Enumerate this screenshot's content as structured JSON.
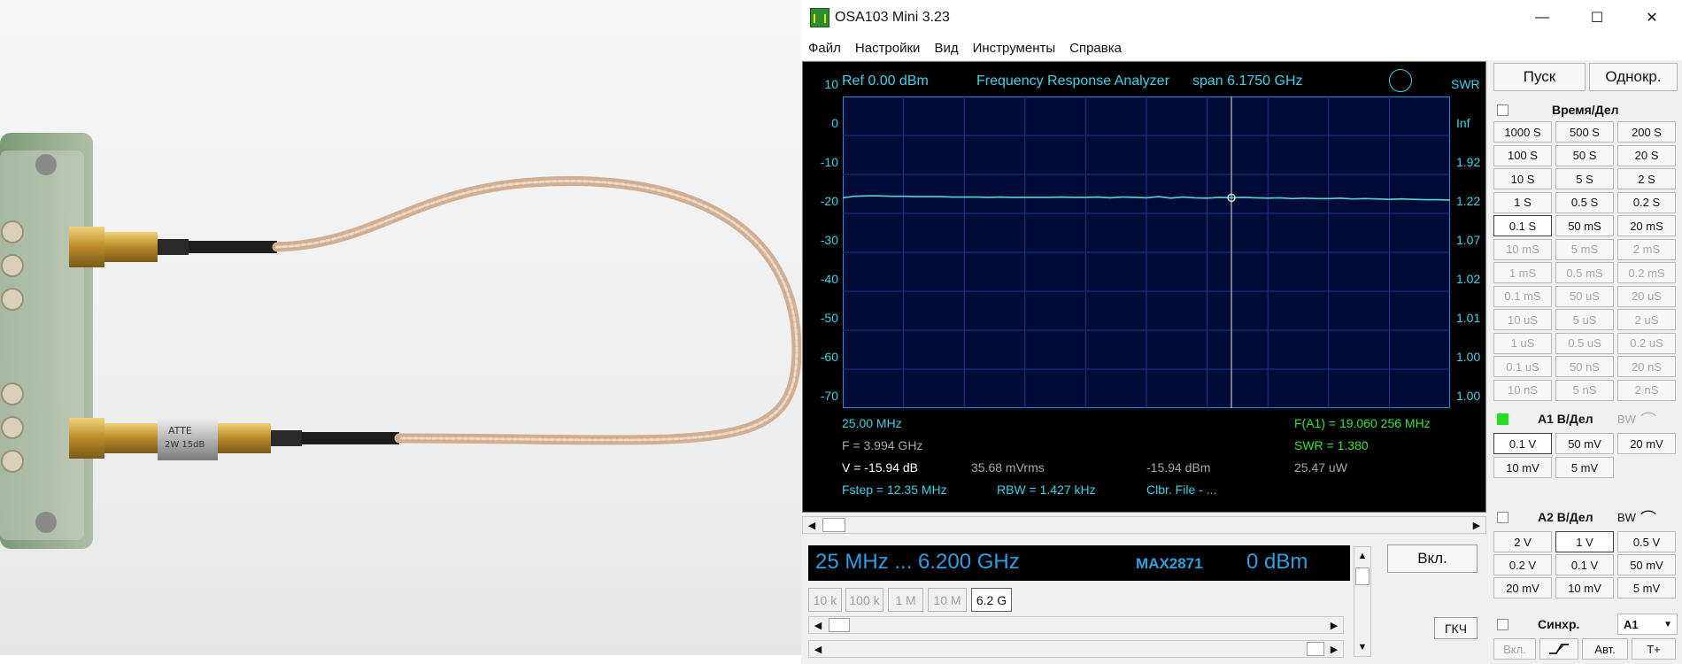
{
  "window": {
    "title": "OSA103 Mini 3.23",
    "controls": [
      "—",
      "☐",
      "✕"
    ]
  },
  "menu": [
    "Файл",
    "Настройки",
    "Вид",
    "Инструменты",
    "Справка"
  ],
  "display": {
    "ref": "Ref  0.00 dBm",
    "mode": "Frequency Response Analyzer",
    "span": "span 6.1750 GHz",
    "left_axis": [
      "10",
      "0",
      "-10",
      "-20",
      "-30",
      "-40",
      "-50",
      "-60",
      "-70"
    ],
    "right_axis_title": "SWR",
    "right_axis": [
      "Inf",
      "1.92",
      "1.22",
      "1.07",
      "1.02",
      "1.01",
      "1.00",
      "1.00"
    ],
    "start_freq": "25.00 MHz",
    "f_marker": "F = 3.994 GHz",
    "v_value": "V = -15.94 dB",
    "mvrms": "35.68 mVrms",
    "dbm": "-15.94 dBm",
    "fstep": "Fstep = 12.35 MHz",
    "rbw": "RBW = 1.427 kHz",
    "clbr": "Clbr. File - ...",
    "f_a1": "F(A1) = 19.060 256 MHz",
    "swr": "SWR = 1.380",
    "power": "25.47 uW"
  },
  "chart_data": {
    "type": "line",
    "ylim": [
      -70,
      10
    ],
    "marker_fraction": 0.64,
    "series": [
      {
        "values": [
          -16.0,
          -15.6,
          -15.5,
          -15.5,
          -15.6,
          -15.6,
          -15.7,
          -15.7,
          -15.7,
          -15.8,
          -15.8,
          -15.8,
          -15.9,
          -15.8,
          -15.9,
          -15.9,
          -15.9,
          -15.9,
          -15.8,
          -15.9,
          -15.9,
          -15.8,
          -16.0,
          -15.8,
          -15.9,
          -16.0,
          -15.7,
          -16.1,
          -15.8,
          -16.0,
          -16.1,
          -15.9,
          -16.0,
          -15.9,
          -16.0,
          -16.1,
          -16.0,
          -16.2,
          -16.1,
          -16.2,
          -16.2,
          -16.1,
          -16.3,
          -16.2,
          -16.3,
          -16.4,
          -16.3,
          -16.4,
          -16.5,
          -16.5,
          -16.6
        ]
      }
    ]
  },
  "generator": {
    "range": "25 MHz  ...  6.200 GHz",
    "chip": "MAX2871",
    "level": "0 dBm",
    "on_button": "Вкл.",
    "mode_button": "ГКЧ",
    "steps": [
      "10 k",
      "100 k",
      "1 M",
      "10 M",
      "6.2 G"
    ]
  },
  "panel": {
    "start": "Пуск",
    "single": "Однокр.",
    "time_div": "Время/Дел",
    "time_buttons": [
      "1000 S",
      "500 S",
      "200 S",
      "100 S",
      "50 S",
      "20 S",
      "10 S",
      "5 S",
      "2 S",
      "1 S",
      "0.5 S",
      "0.2 S",
      "0.1 S",
      "50 mS",
      "20 mS",
      "10 mS",
      "5 mS",
      "2 mS",
      "1 mS",
      "0.5 mS",
      "0.2 mS",
      "0.1 mS",
      "50 uS",
      "20 uS",
      "10 uS",
      "5 uS",
      "2 uS",
      "1 uS",
      "0.5 uS",
      "0.2 uS",
      "0.1 uS",
      "50 nS",
      "20 nS",
      "10 nS",
      "5 nS",
      "2 nS"
    ],
    "a1_title": "A1 В/Дел",
    "a1_bw": "BW",
    "a1_buttons": [
      "0.1 V",
      "50 mV",
      "20 mV",
      "10 mV",
      "5 mV"
    ],
    "a2_title": "A2 В/Дел",
    "a2_bw": "BW",
    "a2_buttons": [
      "2 V",
      "1 V",
      "0.5 V",
      "0.2 V",
      "0.1 V",
      "50 mV",
      "20 mV",
      "10 mV",
      "5 mV"
    ],
    "sync": "Синхр.",
    "sync_select": "A1",
    "sync_on": "Вкл.",
    "auto": "Авт.",
    "tplus": "T+"
  }
}
